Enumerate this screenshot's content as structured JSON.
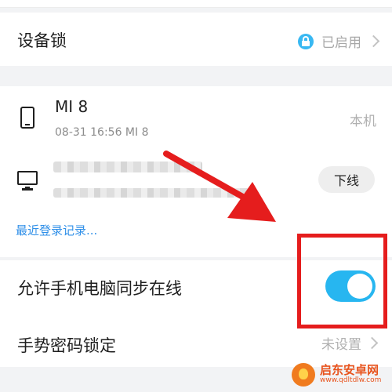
{
  "device_lock": {
    "label": "设备锁",
    "status": "已启用",
    "icon": "lock-icon"
  },
  "devices": [
    {
      "name": "MI 8",
      "detail": "08-31 16:56 MI 8",
      "tag": "本机",
      "icon": "phone-icon"
    },
    {
      "action": "下线",
      "icon": "monitor-icon"
    }
  ],
  "login_history_link": "最近登录记录...",
  "sync_online": {
    "label": "允许手机电脑同步在线",
    "enabled": true
  },
  "gesture_lock": {
    "label": "手势密码锁定",
    "status": "未设置"
  },
  "watermark": {
    "title": "启东安卓网",
    "url": "www.qdltdlw.com"
  },
  "colors": {
    "accent": "#27b6f0",
    "link": "#2f8fe8",
    "annotation": "#e51d1d"
  }
}
